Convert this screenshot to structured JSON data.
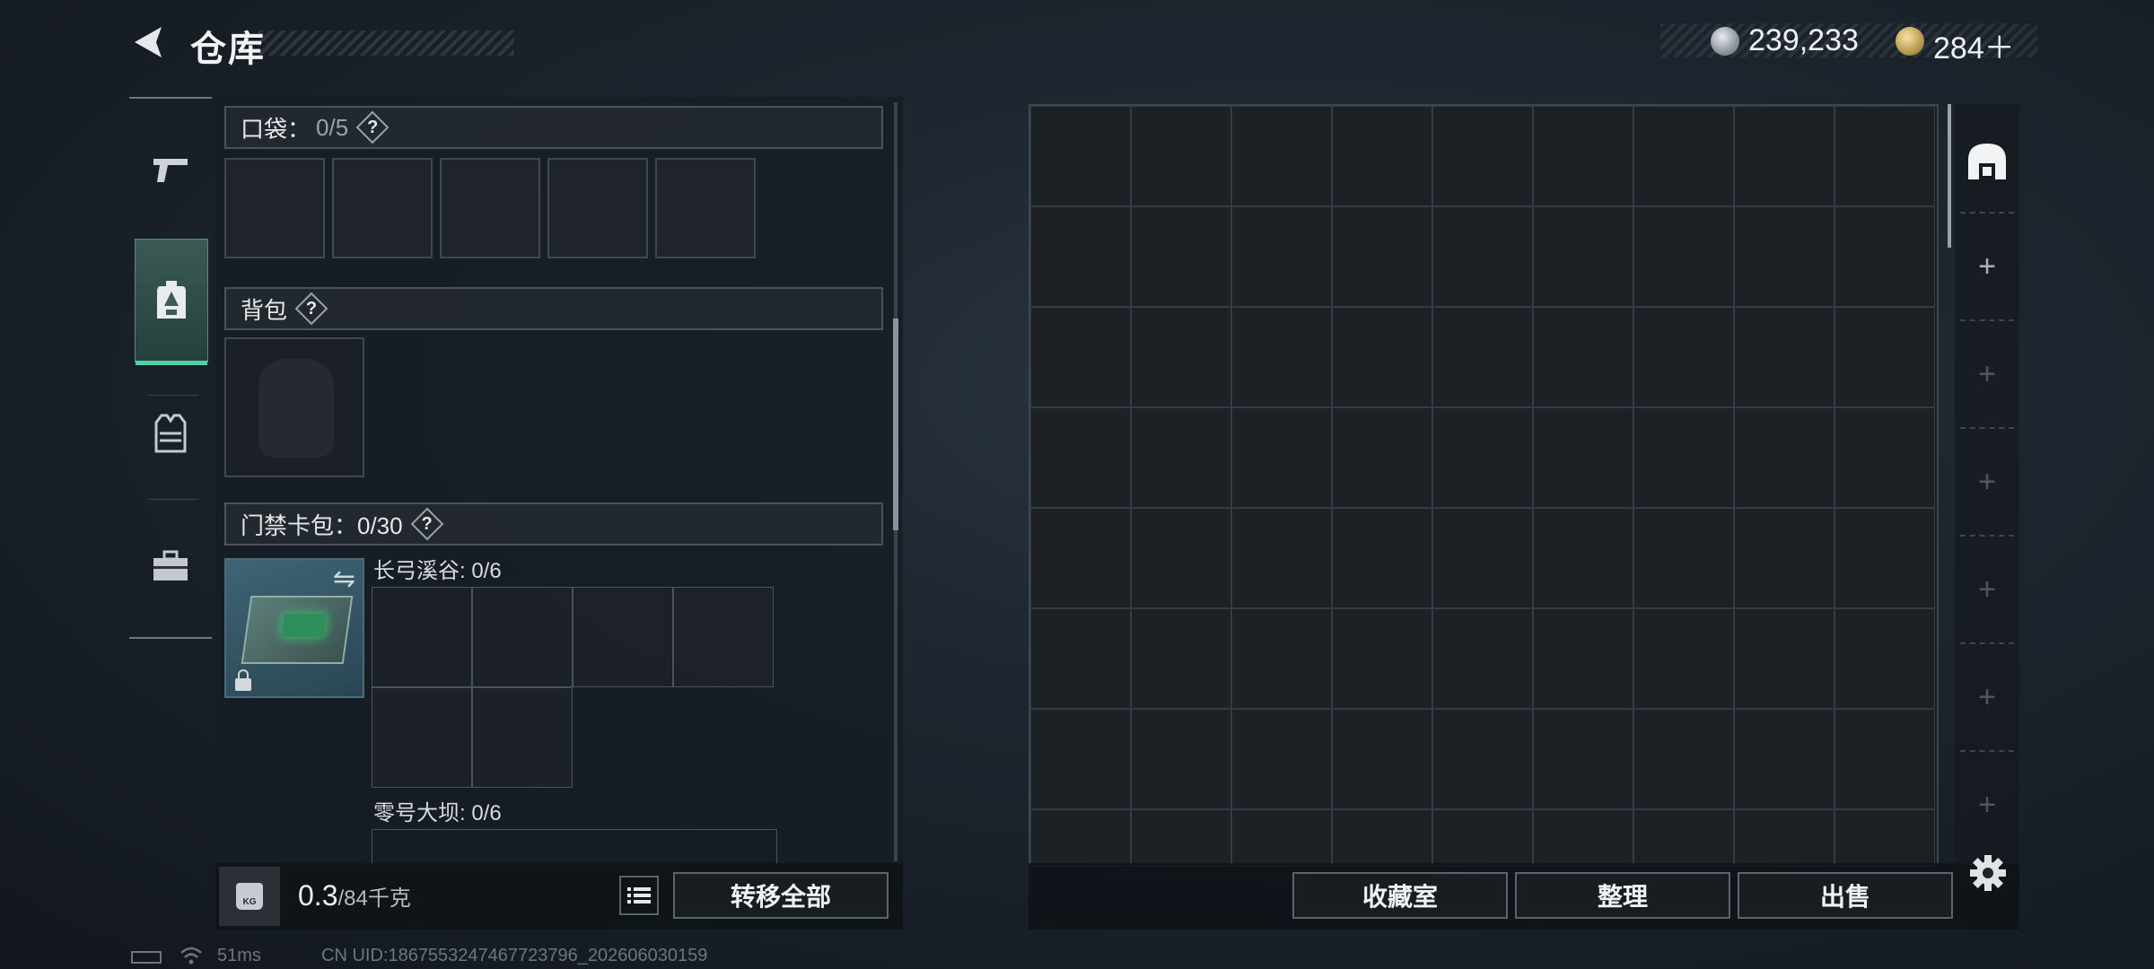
{
  "header": {
    "title": "仓库",
    "currency": [
      {
        "icon": "silver-coin-icon",
        "value": "239,233"
      },
      {
        "icon": "gold-coin-icon",
        "value": "284＋"
      }
    ]
  },
  "nav": {
    "items": [
      {
        "name": "weapons",
        "icon": "pistol-icon",
        "active": false
      },
      {
        "name": "backpack",
        "icon": "backpack-icon",
        "active": true
      },
      {
        "name": "vest",
        "icon": "vest-icon",
        "active": false
      },
      {
        "name": "case",
        "icon": "briefcase-icon",
        "active": false
      }
    ]
  },
  "left": {
    "pocket": {
      "label": "口袋：",
      "count": "0/5",
      "help": "?"
    },
    "backpack": {
      "label": "背包",
      "help": "?"
    },
    "keycard": {
      "label": "门禁卡包：0/30",
      "help": "?"
    },
    "map1": "长弓溪谷: 0/6",
    "map2": "零号大坝: 0/6"
  },
  "weight": {
    "current": "0.3",
    "max": "/84千克",
    "icon_text": "KG"
  },
  "buttons": {
    "transfer_all": "转移全部",
    "favorites": "收藏室",
    "organize": "整理",
    "sell": "出售"
  },
  "status": {
    "ping": "51ms",
    "uid": "CN UID:1867553247467723796_202606030159"
  },
  "colors": {
    "accent": "#4fd0a6",
    "panel": "#1a1e23"
  }
}
